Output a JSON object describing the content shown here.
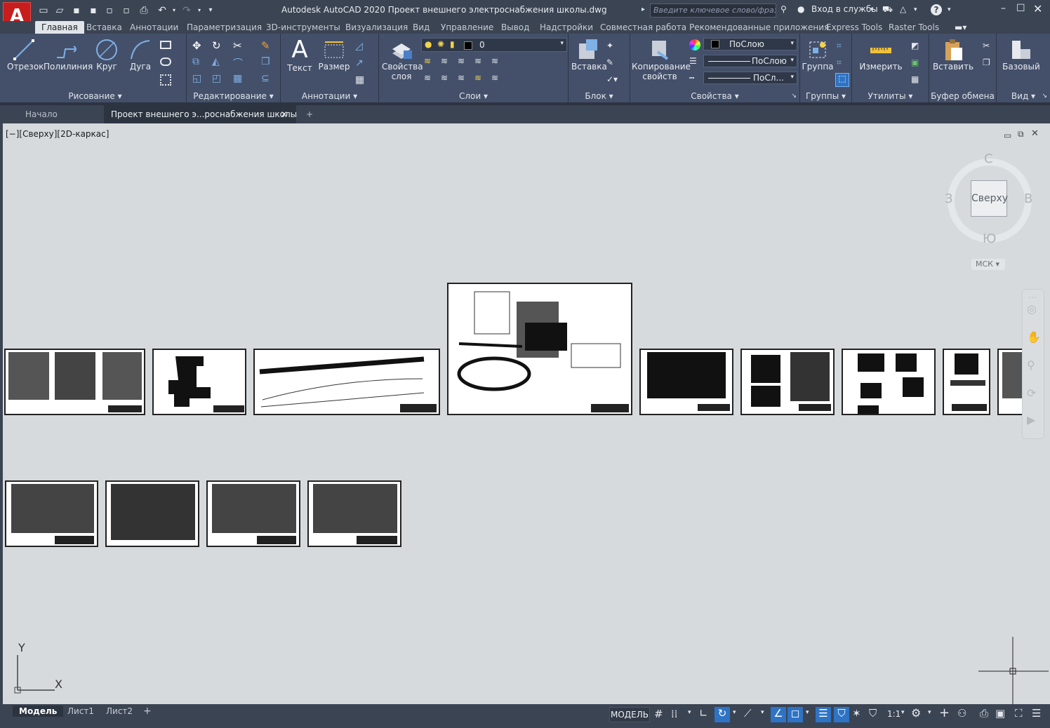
{
  "app": {
    "logo_letter": "A",
    "title": "Autodesk AutoCAD 2020   Проект внешнего электроснабжения школы.dwg",
    "search_placeholder": "Введите ключевое слово/фразу",
    "signin": "Вход в службы",
    "help": "?"
  },
  "ribbon_tabs": [
    "Главная",
    "Вставка",
    "Аннотации",
    "Параметризация",
    "3D-инструменты",
    "Визуализация",
    "Вид",
    "Управление",
    "Вывод",
    "Надстройки",
    "Совместная работа",
    "Рекомендованные приложения",
    "Express Tools",
    "Raster Tools"
  ],
  "panels": {
    "draw": {
      "label": "Рисование",
      "buttons": [
        "Отрезок",
        "Полилиния",
        "Круг",
        "Дуга"
      ]
    },
    "modify": {
      "label": "Редактирование"
    },
    "annotation": {
      "label": "Аннотации",
      "buttons": [
        "Текст",
        "Размер"
      ]
    },
    "layers": {
      "label": "Слои",
      "button": "Свойства слоя",
      "layer_name": "0"
    },
    "block": {
      "label": "Блок",
      "button": "Вставка"
    },
    "properties": {
      "label": "Свойства",
      "button": "Копирование свойств",
      "color": "ПоСлою",
      "linetype": "ПоСлою",
      "lineweight": "ПоСл..."
    },
    "groups": {
      "label": "Группы",
      "button": "Группа"
    },
    "utilities": {
      "label": "Утилиты",
      "button": "Измерить"
    },
    "clipboard": {
      "label": "Буфер обмена",
      "button": "Вставить"
    },
    "view": {
      "label": "Вид",
      "button": "Базовый"
    }
  },
  "file_tabs": {
    "start": "Начало",
    "doc": "Проект внешнего э...роснабжения школы",
    "add": "+"
  },
  "viewport": {
    "label": "[−][Сверху][2D-каркас]",
    "viewcube": {
      "top": "Сверху",
      "n": "С",
      "s": "Ю",
      "w": "З",
      "e": "В",
      "ucs": "МСК"
    },
    "axis": {
      "x": "X",
      "y": "Y"
    }
  },
  "layout_tabs": [
    "Модель",
    "Лист1",
    "Лист2"
  ],
  "status": {
    "space": "МОДЕЛЬ",
    "scale": "1:1"
  },
  "colors": {
    "accent": "#c81d1d",
    "bg": "#3b4453",
    "ribbon": "#44506a",
    "canvas": "#d6dadc",
    "highlight": "#2e73c4"
  }
}
